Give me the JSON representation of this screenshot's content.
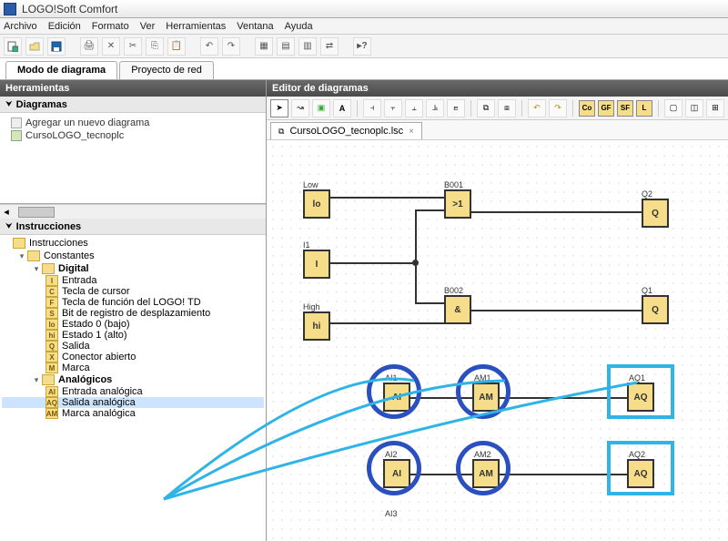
{
  "title": "LOGO!Soft Comfort",
  "menu": [
    "Archivo",
    "Edición",
    "Formato",
    "Ver",
    "Herramientas",
    "Ventana",
    "Ayuda"
  ],
  "main_tabs": {
    "diagram": "Modo de diagrama",
    "project": "Proyecto de red"
  },
  "left": {
    "tools_hdr": "Herramientas",
    "diagrams_hdr": "Diagramas",
    "add_diagram": "Agregar un nuevo diagrama",
    "current_diagram": "CursoLOGO_tecnoplc",
    "instructions_hdr": "Instrucciones",
    "tree": {
      "instrucciones": "Instrucciones",
      "constantes": "Constantes",
      "digital": "Digital",
      "digital_items": [
        {
          "tag": "I",
          "label": "Entrada"
        },
        {
          "tag": "C",
          "label": "Tecla de cursor"
        },
        {
          "tag": "F",
          "label": "Tecla de función del LOGO! TD"
        },
        {
          "tag": "S",
          "label": "Bit de registro de desplazamiento"
        },
        {
          "tag": "lo",
          "label": "Estado 0 (bajo)"
        },
        {
          "tag": "hi",
          "label": "Estado 1 (alto)"
        },
        {
          "tag": "Q",
          "label": "Salida"
        },
        {
          "tag": "X",
          "label": "Conector abierto"
        },
        {
          "tag": "M",
          "label": "Marca"
        }
      ],
      "analogicos": "Analógicos",
      "analog_items": [
        {
          "tag": "AI",
          "label": "Entrada analógica"
        },
        {
          "tag": "AQ",
          "label": "Salida analógica"
        },
        {
          "tag": "AM",
          "label": "Marca analógica"
        }
      ]
    }
  },
  "editor": {
    "hdr": "Editor de diagramas",
    "colorbtns": [
      "Co",
      "GF",
      "SF",
      "L"
    ],
    "doc_tab": "CursoLOGO_tecnoplc.lsc",
    "blocks": {
      "low": "lo",
      "i1": "I",
      "high": "hi",
      "b001": ">1",
      "b002": "&",
      "q1": "Q",
      "q2": "Q",
      "ai": "AI",
      "am": "AM",
      "aq": "AQ"
    },
    "labels": {
      "low": "Low",
      "i1": "I1",
      "high": "High",
      "b001": "B001",
      "b002": "B002",
      "q1": "Q1",
      "q2": "Q2",
      "ai1": "AI1",
      "ai2": "AI2",
      "ai3": "AI3",
      "am1": "AM1",
      "am2": "AM2",
      "aq1": "AQ1",
      "aq2": "AQ2"
    }
  }
}
